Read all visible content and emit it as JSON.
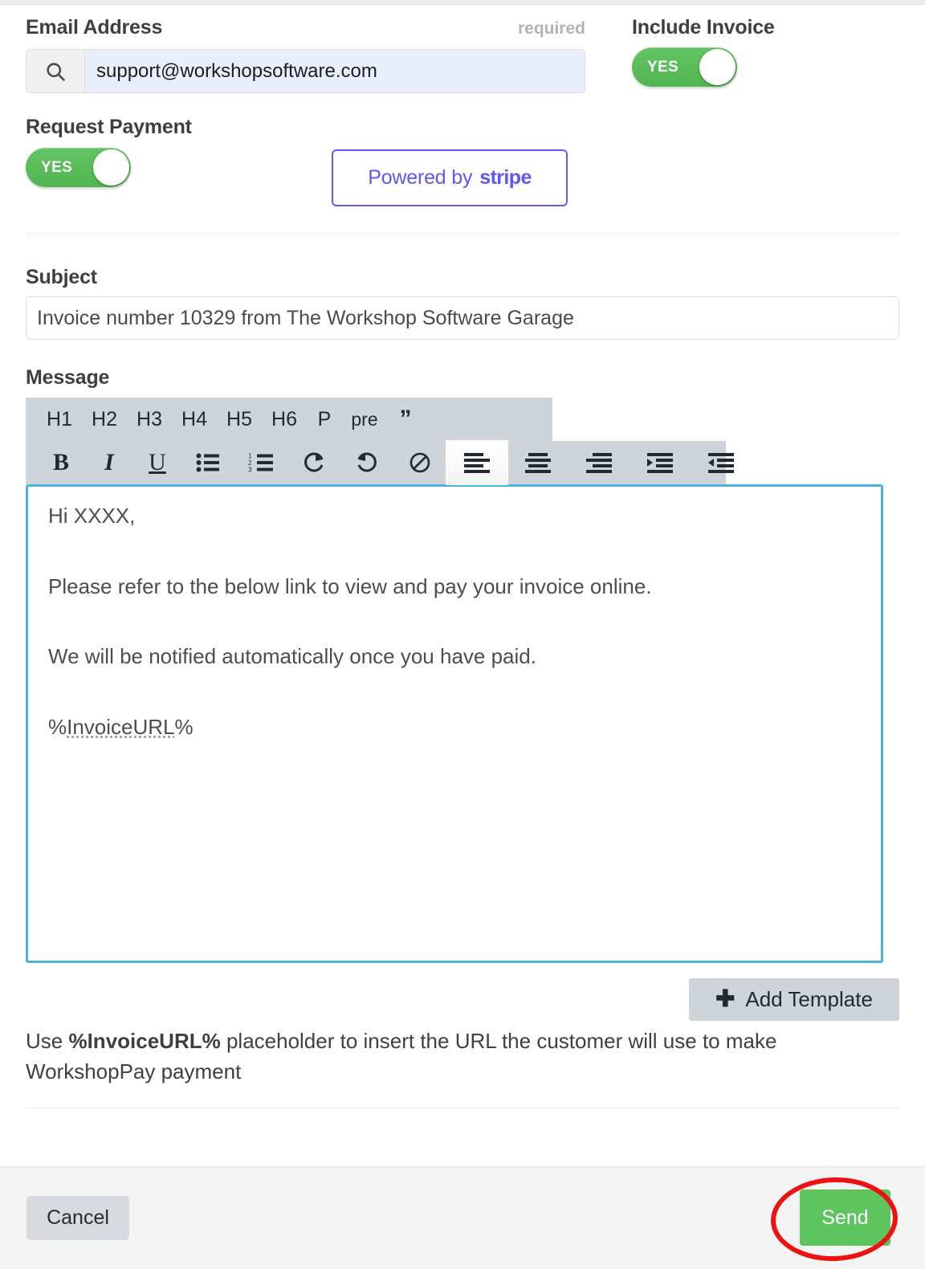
{
  "email": {
    "label": "Email Address",
    "required_tag": "required",
    "icon": "search-icon",
    "value": "support@workshopsoftware.com",
    "placeholder": "Email Address"
  },
  "include_invoice": {
    "label": "Include Invoice",
    "toggle_state": "YES"
  },
  "request_payment": {
    "label": "Request Payment",
    "toggle_state": "YES"
  },
  "stripe": {
    "prefix": "Powered by",
    "brand": "stripe",
    "border_color": "#6259f5"
  },
  "subject": {
    "label": "Subject",
    "value": "Invoice number 10329 from The Workshop Software Garage",
    "placeholder": "Subject"
  },
  "message": {
    "label": "Message",
    "toolbar_row1": [
      {
        "name": "heading-1-button",
        "label": "H1"
      },
      {
        "name": "heading-2-button",
        "label": "H2"
      },
      {
        "name": "heading-3-button",
        "label": "H3"
      },
      {
        "name": "heading-4-button",
        "label": "H4"
      },
      {
        "name": "heading-5-button",
        "label": "H5"
      },
      {
        "name": "heading-6-button",
        "label": "H6"
      },
      {
        "name": "paragraph-button",
        "label": "P"
      },
      {
        "name": "preformatted-button",
        "label": "pre"
      },
      {
        "name": "blockquote-button",
        "label": "”"
      }
    ],
    "toolbar_row2": [
      {
        "name": "bold-button",
        "label": "B"
      },
      {
        "name": "italic-button",
        "label": "I"
      },
      {
        "name": "underline-button",
        "label": "U"
      },
      {
        "name": "bullet-list-icon",
        "label": ""
      },
      {
        "name": "numbered-list-icon",
        "label": ""
      },
      {
        "name": "redo-icon",
        "label": ""
      },
      {
        "name": "undo-icon",
        "label": ""
      },
      {
        "name": "clear-formatting-icon",
        "label": ""
      },
      {
        "name": "align-left-icon",
        "label": ""
      },
      {
        "name": "align-center-icon",
        "label": ""
      },
      {
        "name": "align-right-icon",
        "label": ""
      },
      {
        "name": "indent-icon",
        "label": ""
      },
      {
        "name": "outdent-icon",
        "label": ""
      }
    ],
    "active_tool": "align-left-icon",
    "body": {
      "line1": "Hi XXXX,",
      "line2": "Please refer to the below link to view and pay your invoice online.",
      "line3": "We will be notified automatically once you have paid.",
      "line4_prefix": "%",
      "line4_token": "InvoiceURL",
      "line4_suffix": "%"
    },
    "editor_border_color": "#4fb2d8"
  },
  "add_template": {
    "label": "Add Template",
    "icon": "plus-icon"
  },
  "helper": {
    "part1": "Use ",
    "bold": "%InvoiceURL%",
    "part2": " placeholder to insert the URL the customer will use to make WorkshopPay payment"
  },
  "footer": {
    "cancel_label": "Cancel",
    "send_label": "Send",
    "send_color": "#5ec45e",
    "annotation": "red-ellipse-highlight"
  }
}
